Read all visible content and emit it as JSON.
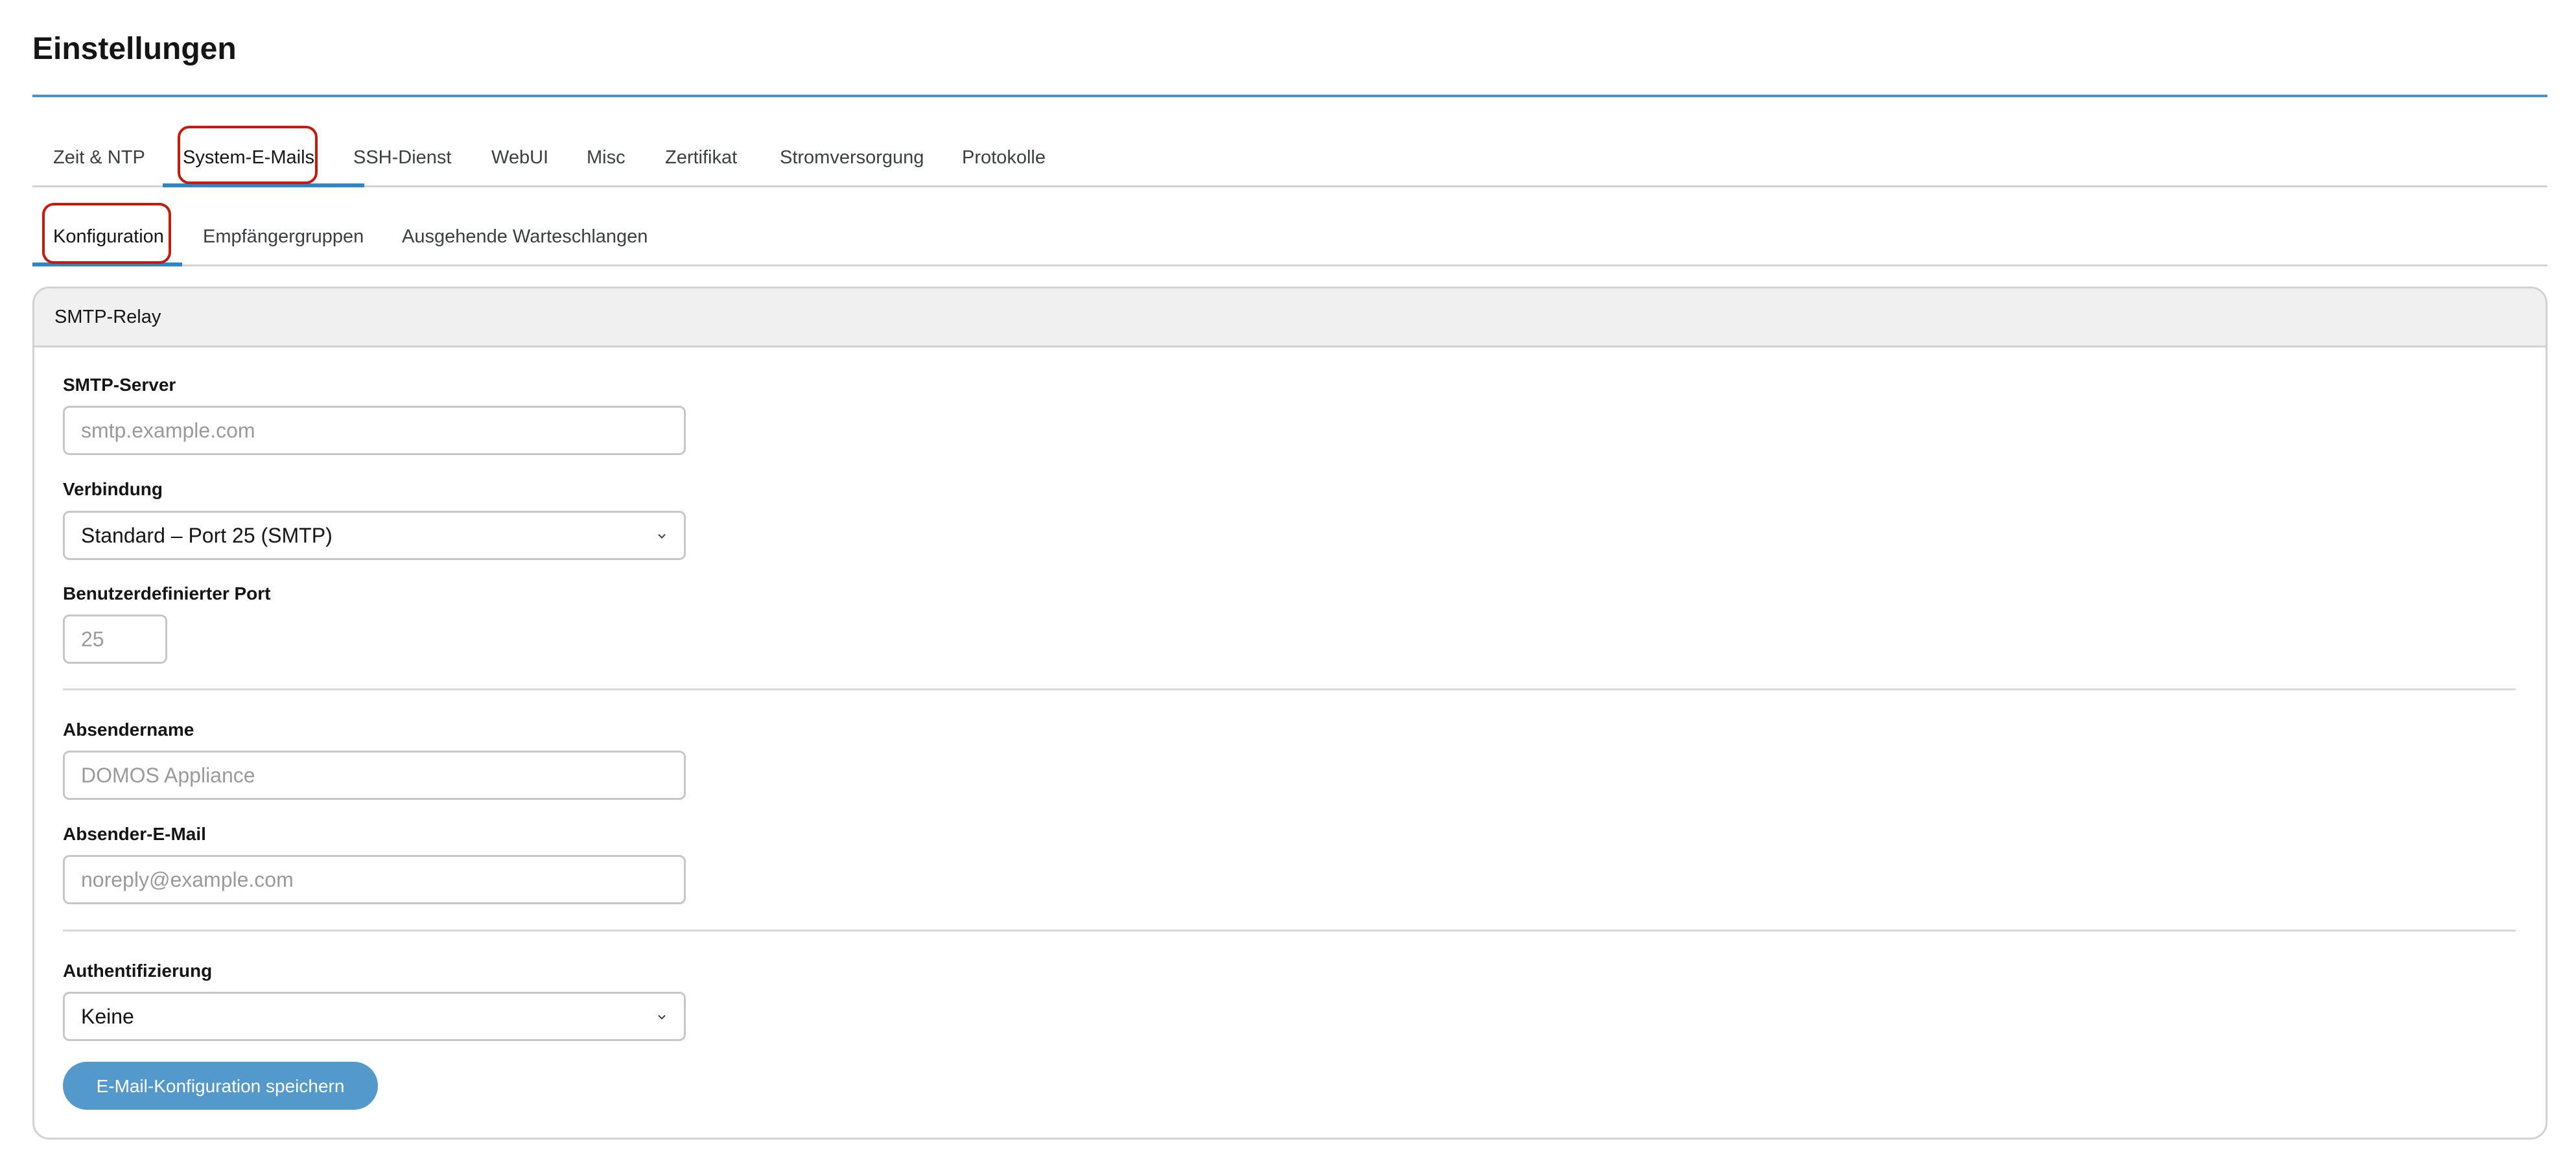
{
  "page": {
    "title": "Einstellungen"
  },
  "main_tabs": [
    {
      "label": "Zeit & NTP"
    },
    {
      "label": "System-E-Mails"
    },
    {
      "label": "SSH-Dienst"
    },
    {
      "label": "WebUI"
    },
    {
      "label": "Misc"
    },
    {
      "label": "Zertifikat"
    },
    {
      "label": "Stromversorgung"
    },
    {
      "label": "Protokolle"
    }
  ],
  "active_main_tab": "System-E-Mails",
  "sub_tabs": [
    {
      "label": "Konfiguration"
    },
    {
      "label": "Empfängergruppen"
    },
    {
      "label": "Ausgehende Warteschlangen"
    }
  ],
  "active_sub_tab": "Konfiguration",
  "card": {
    "title": "SMTP-Relay"
  },
  "form": {
    "smtp_server": {
      "label": "SMTP-Server",
      "value": "",
      "placeholder": "smtp.example.com"
    },
    "connection": {
      "label": "Verbindung",
      "selected": "Standard – Port 25 (SMTP)"
    },
    "custom_port": {
      "label": "Benutzerdefinierter Port",
      "value": "",
      "placeholder": "25"
    },
    "sender_name": {
      "label": "Absendername",
      "value": "",
      "placeholder": "DOMOS Appliance"
    },
    "sender_email": {
      "label": "Absender-E-Mail",
      "value": "",
      "placeholder": "noreply@example.com"
    },
    "authentication": {
      "label": "Authentifizierung",
      "selected": "Keine"
    },
    "save_button": "E-Mail-Konfiguration speichern"
  },
  "colors": {
    "accent": "#2b87c7",
    "button": "#5499cc",
    "highlight": "#c9190b"
  },
  "icons": {
    "select_indicator": "chevron-down-icon"
  }
}
